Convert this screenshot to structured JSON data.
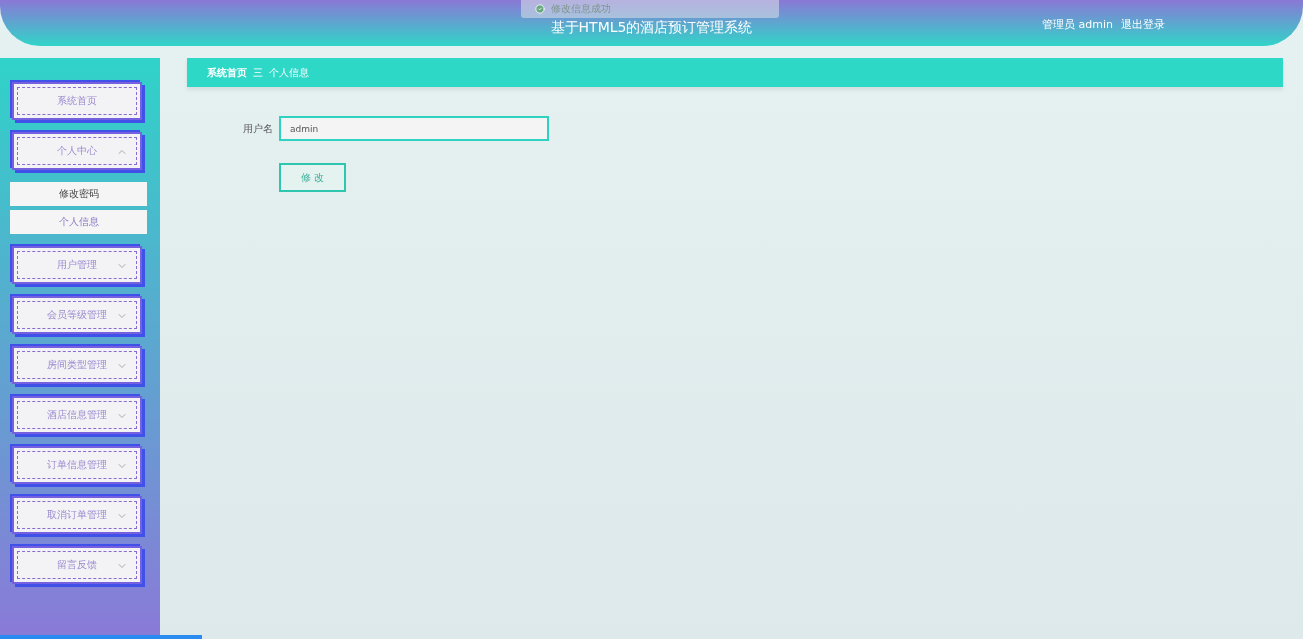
{
  "toast": {
    "text": "修改信息成功"
  },
  "header": {
    "title": "基于HTML5的酒店预订管理系统",
    "user": "管理员 admin",
    "logout": "退出登录"
  },
  "sidebar": {
    "items": [
      {
        "kind": "link",
        "label": "系统首页"
      },
      {
        "kind": "group",
        "label": "个人中心",
        "expanded": true,
        "children": [
          {
            "label": "修改密码"
          },
          {
            "label": "个人信息"
          }
        ]
      },
      {
        "kind": "group",
        "label": "用户管理",
        "expanded": false
      },
      {
        "kind": "group",
        "label": "会员等级管理",
        "expanded": false
      },
      {
        "kind": "group",
        "label": "房间类型管理",
        "expanded": false
      },
      {
        "kind": "group",
        "label": "酒店信息管理",
        "expanded": false
      },
      {
        "kind": "group",
        "label": "订单信息管理",
        "expanded": false
      },
      {
        "kind": "group",
        "label": "取消订单管理",
        "expanded": false
      },
      {
        "kind": "group",
        "label": "留言反馈",
        "expanded": false
      }
    ]
  },
  "breadcrumb": {
    "items": [
      "系统首页",
      "个人信息"
    ],
    "separator": "三"
  },
  "form": {
    "fields": [
      {
        "label": "用户名",
        "value": "admin"
      }
    ],
    "submit": "修 改"
  },
  "loading_bar": {
    "level": 0.155
  }
}
